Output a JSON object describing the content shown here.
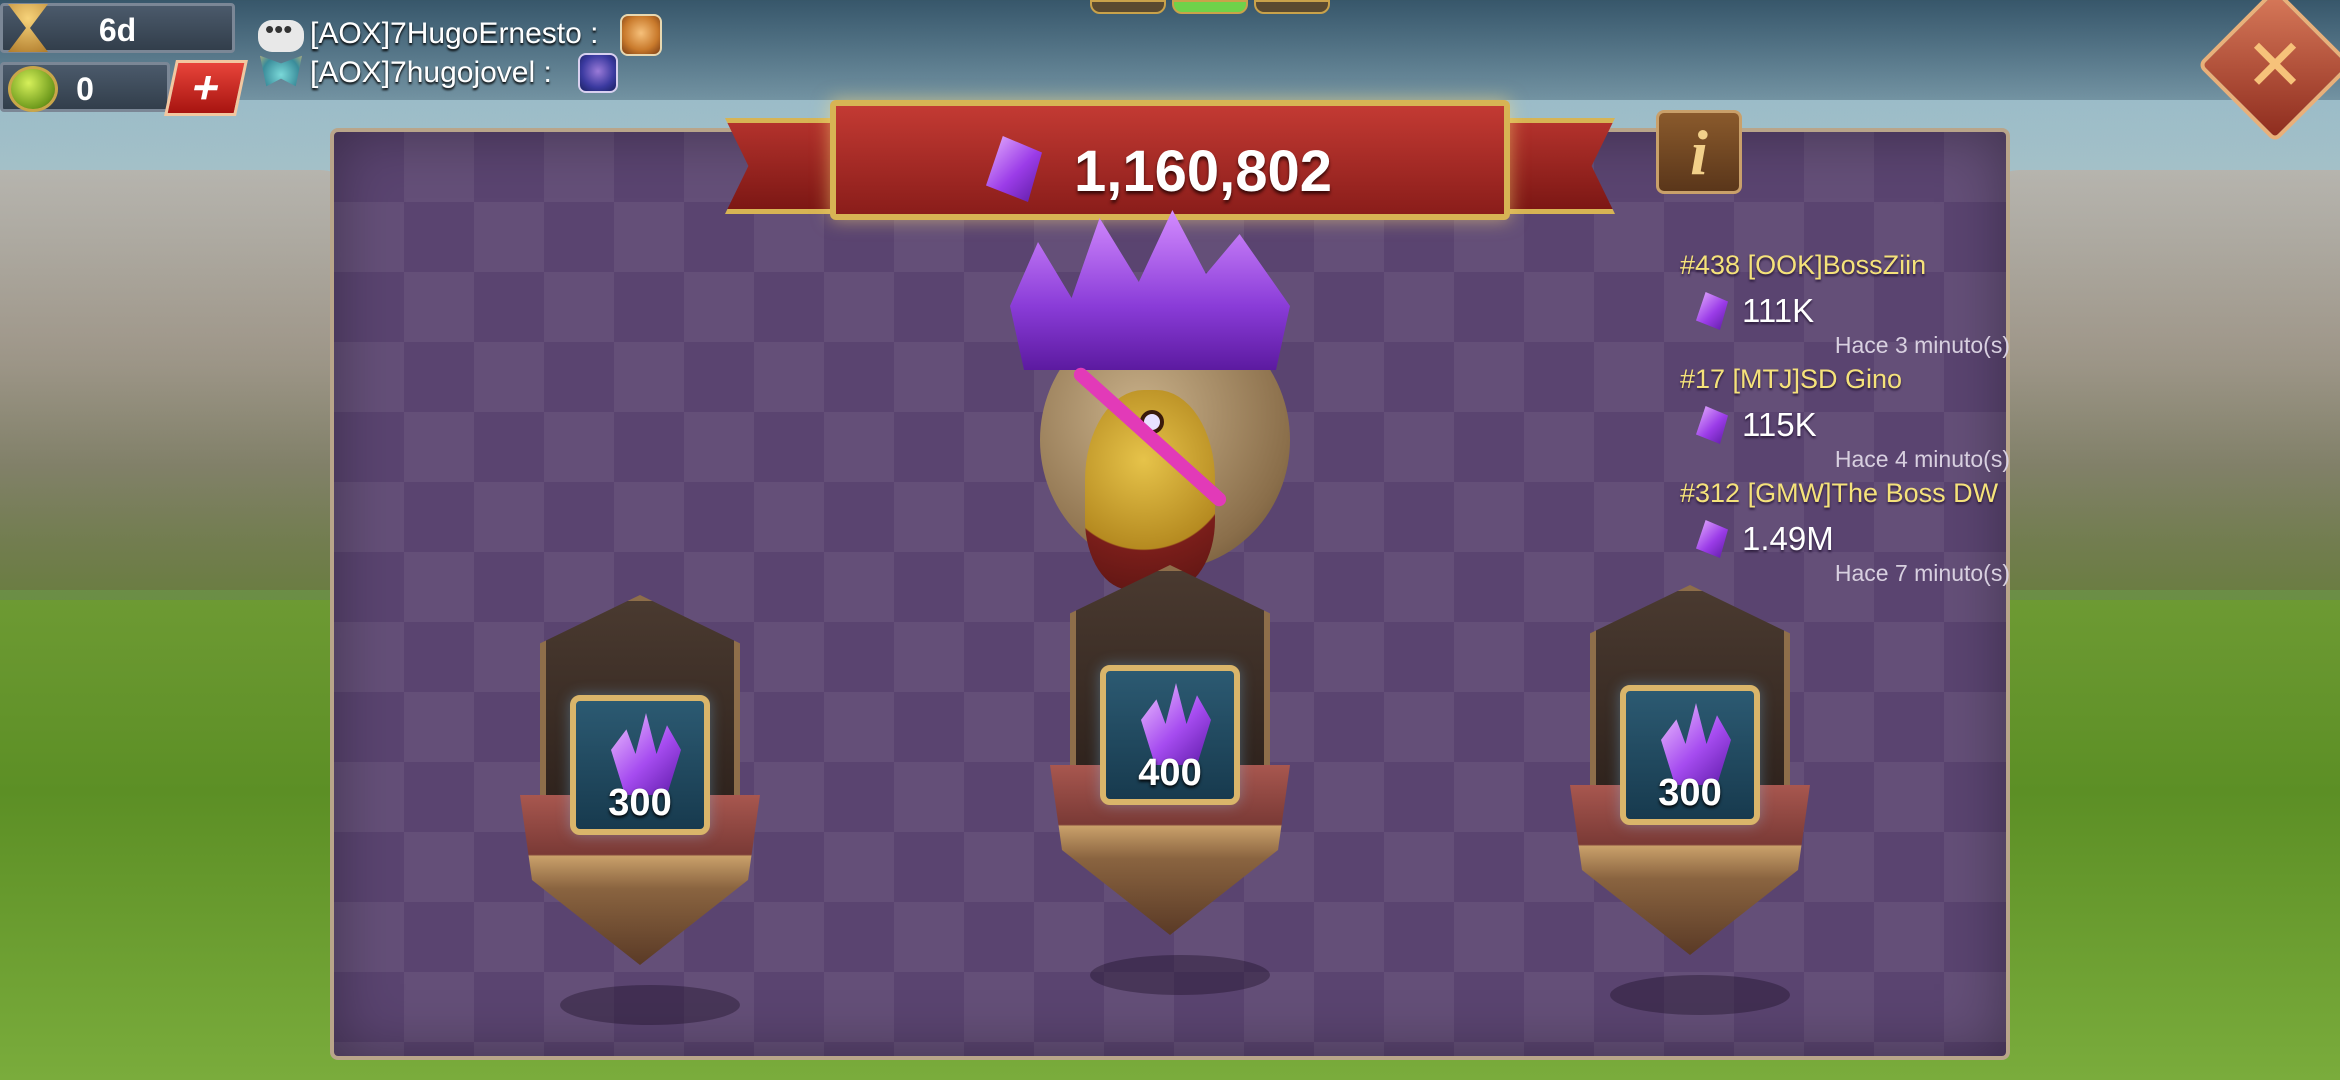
{
  "status_bar": {
    "timer_value": "6d",
    "coins_value": "0",
    "add_label": "+"
  },
  "chat": {
    "line1_name": "[AOX]7HugoErnesto :",
    "line2_name": "[AOX]7hugojovel :"
  },
  "banner": {
    "total": "1,160,802"
  },
  "info_label": "i",
  "close_label": "✕",
  "feed": [
    {
      "player": "#438 [OOK]BossZiin",
      "amount": "111K",
      "time": "Hace 3 minuto(s)"
    },
    {
      "player": "#17 [MTJ]SD Gino",
      "amount": "115K",
      "time": "Hace 4 minuto(s)"
    },
    {
      "player": "#312 [GMW]The Boss DW",
      "amount": "1.49M",
      "time": "Hace 7 minuto(s)"
    }
  ],
  "rewards": [
    {
      "amount": "300"
    },
    {
      "amount": "400"
    },
    {
      "amount": "300"
    }
  ],
  "pager": {
    "count": 3,
    "active_index": 1
  },
  "colors": {
    "accent_gold": "#d7b454",
    "banner_red": "#c33a33",
    "gem_purple": "#9b3ce8",
    "feed_name_yellow": "#f5e27a"
  },
  "icons": [
    "hourglass-icon",
    "coin-icon",
    "chat-icon",
    "wings-icon",
    "gem-icon",
    "crystal-icon",
    "close-icon",
    "info-icon"
  ]
}
